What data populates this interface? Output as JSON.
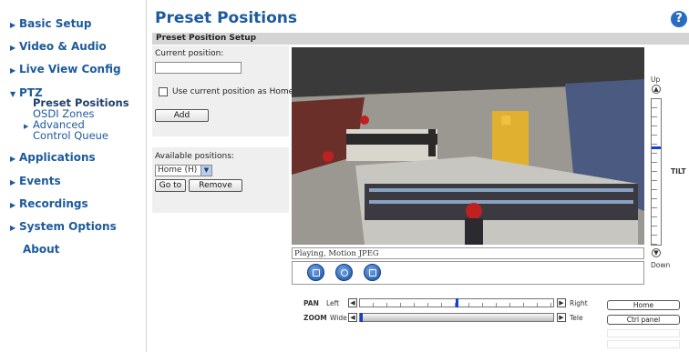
{
  "sidebar": {
    "items": [
      {
        "label": "Basic Setup"
      },
      {
        "label": "Video & Audio"
      },
      {
        "label": "Live View Config"
      },
      {
        "label": "PTZ"
      },
      {
        "label": "Applications"
      },
      {
        "label": "Events"
      },
      {
        "label": "Recordings"
      },
      {
        "label": "System Options"
      },
      {
        "label": "About"
      }
    ],
    "ptz_sub": {
      "preset_positions": "Preset Positions",
      "osdi_zones": "OSDI Zones",
      "advanced": "Advanced",
      "control_queue": "Control Queue"
    }
  },
  "header": {
    "title": "Preset Positions",
    "help_icon": "?"
  },
  "setup": {
    "section_title": "Preset Position Setup",
    "current_position_label": "Current position:",
    "current_position_value": "",
    "use_current_label": "Use current position as Home",
    "use_current_checked": false,
    "add_label": "Add"
  },
  "available": {
    "label": "Available positions:",
    "selected": "Home (H)",
    "goto_label": "Go to",
    "remove_label": "Remove"
  },
  "video": {
    "status": "Playing, Motion JPEG"
  },
  "tilt": {
    "up_label": "Up",
    "down_label": "Down",
    "axis_label": "TILT",
    "value": 0.33
  },
  "pan": {
    "label": "PAN",
    "left_label": "Left",
    "right_label": "Right",
    "value": 0.5
  },
  "zoom": {
    "label": "ZOOM",
    "wide_label": "Wide",
    "tele_label": "Tele",
    "value": 0.0
  },
  "right_buttons": {
    "home": "Home",
    "ctrl_panel": "Ctrl panel"
  },
  "colors": {
    "link": "#1d5a9c",
    "marker": "#1440d0",
    "section_bar": "#d4d4d4"
  }
}
